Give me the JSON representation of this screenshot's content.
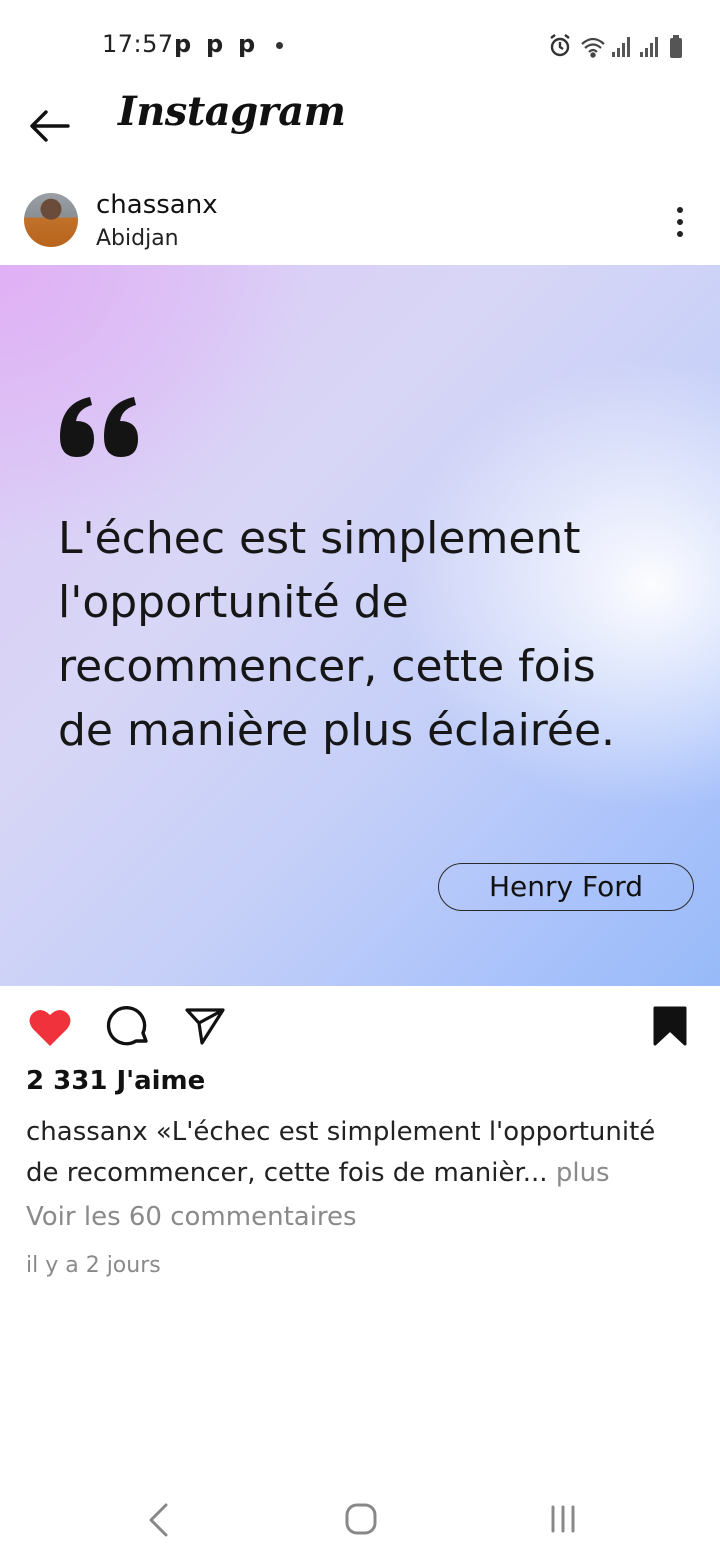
{
  "status_bar": {
    "time": "17:57",
    "notification_icons": [
      "p",
      "p",
      "p"
    ],
    "system_icons": [
      "alarm-icon",
      "wifi-icon",
      "signal-icon",
      "signal-icon",
      "battery-icon"
    ]
  },
  "header": {
    "title": "Instagram",
    "back_icon": "back-arrow-icon"
  },
  "post": {
    "username": "chassanx",
    "location": "Abidjan",
    "quote": "L'échec est simplement l'opportunité de recommencer, cette fois de manière plus éclairée.",
    "author": "Henry Ford",
    "likes": "2 331 J'aime",
    "caption_user": "chassanx",
    "caption_text": " «L'échec est simplement l'opportunité de recommencer, cette fois de manièr... ",
    "caption_more": "plus",
    "view_comments": "Voir les 60 commentaires",
    "time_ago": "il y a 2 jours",
    "liked": true,
    "saved": true
  },
  "colors": {
    "like": "#f0323c",
    "gradient_start": "#e0b0f5",
    "gradient_end": "#97baf8"
  },
  "nav_bar": [
    "nav-back-icon",
    "nav-home-icon",
    "nav-recents-icon"
  ]
}
